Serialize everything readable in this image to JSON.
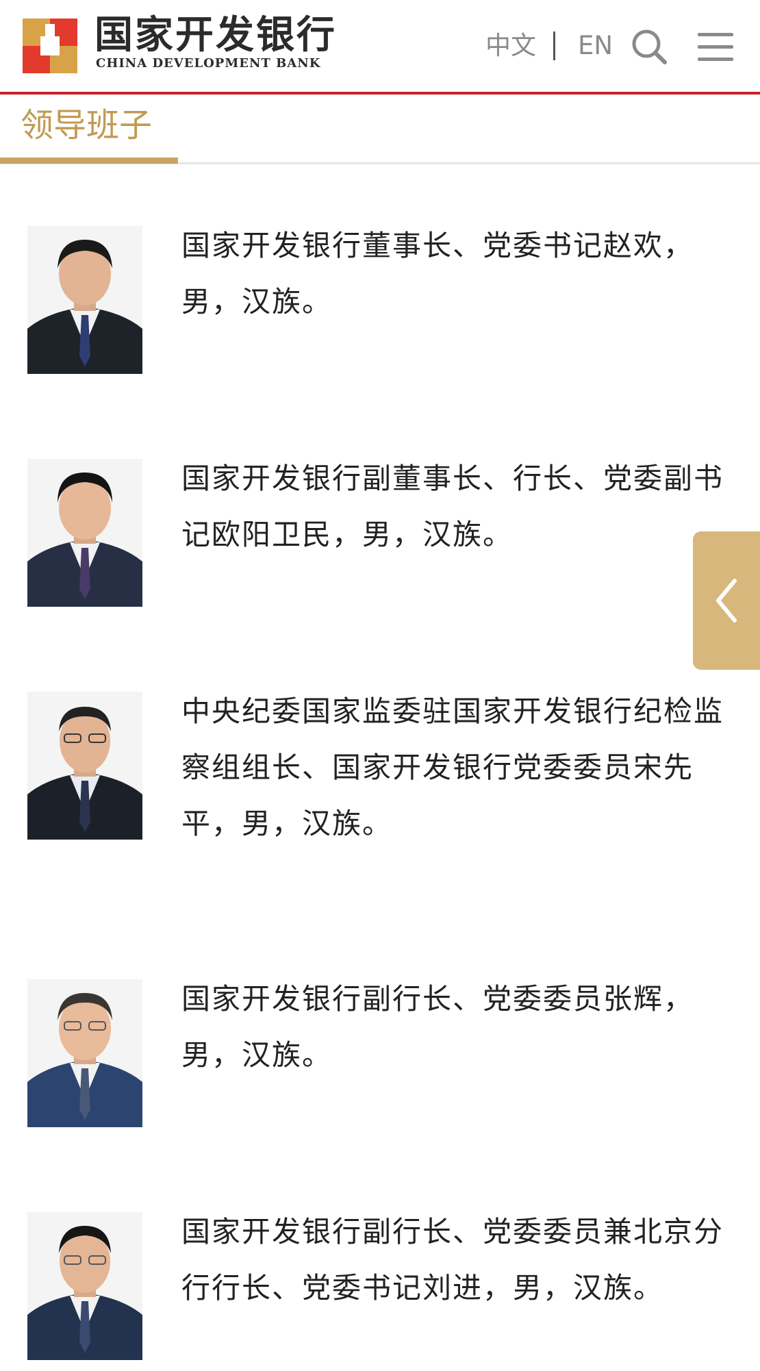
{
  "header": {
    "logo_cn": "国家开发银行",
    "logo_en": "CHINA DEVELOPMENT BANK",
    "lang_zh": "中文",
    "lang_en": "EN",
    "icons": [
      "logo-icon",
      "search-icon",
      "menu-icon"
    ]
  },
  "section": {
    "title": "领导班子",
    "accent_color": "#c09a52"
  },
  "leaders": [
    {
      "text": "国家开发银行董事长、党委书记赵欢，男，汉族。"
    },
    {
      "text": "国家开发银行副董事长、行长、党委副书记欧阳卫民，男，汉族。"
    },
    {
      "text": "中央纪委国家监委驻国家开发银行纪检监察组组长、国家开发银行党委委员宋先平，男，汉族。"
    },
    {
      "text": "国家开发银行副行长、党委委员张辉，男，汉族。"
    },
    {
      "text": "国家开发银行副行长、党委委员兼北京分行行长、党委书记刘进，男，汉族。"
    }
  ],
  "side_tab": {
    "icon": "chevron-left-icon",
    "color": "#d7b77c"
  },
  "colors": {
    "brand_red": "#c8202a",
    "gold": "#c9a463"
  }
}
